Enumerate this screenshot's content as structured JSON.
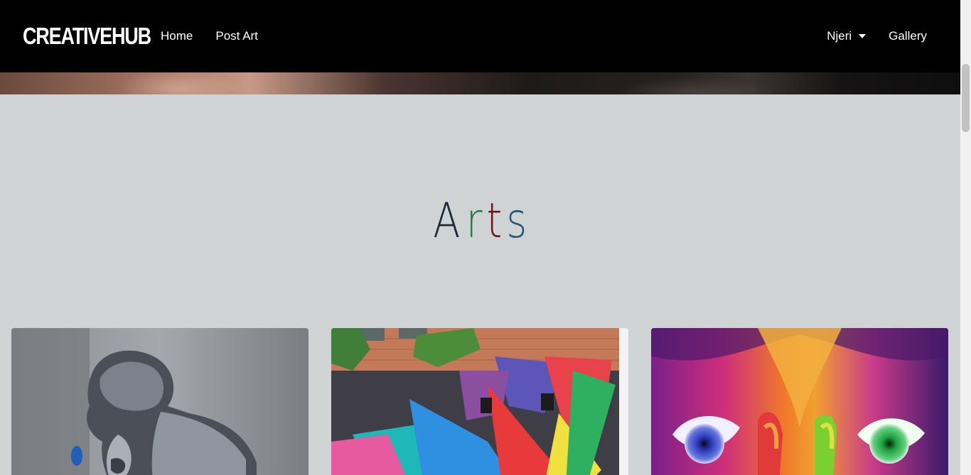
{
  "navbar": {
    "brand": "CREATIVEHUB",
    "links": [
      {
        "label": "Home"
      },
      {
        "label": "Post Art"
      }
    ],
    "user_menu": {
      "label": "Njeri",
      "icon": "caret-down-icon"
    },
    "gallery": {
      "label": "Gallery"
    }
  },
  "main": {
    "heading_letters": [
      {
        "char": "A",
        "color": "#1f2a38"
      },
      {
        "char": "r",
        "color": "#2a7a4f"
      },
      {
        "char": "t",
        "color": "#6b1717"
      },
      {
        "char": "s",
        "color": "#1f5a7a"
      }
    ],
    "cards": [
      {
        "image": "street-art-boy-mural"
      },
      {
        "image": "colorful-spikes-building-mural"
      },
      {
        "image": "rainbow-eyes-face-painting"
      }
    ]
  },
  "colors": {
    "background": "#d0d3d4",
    "navbar": "#000000"
  }
}
